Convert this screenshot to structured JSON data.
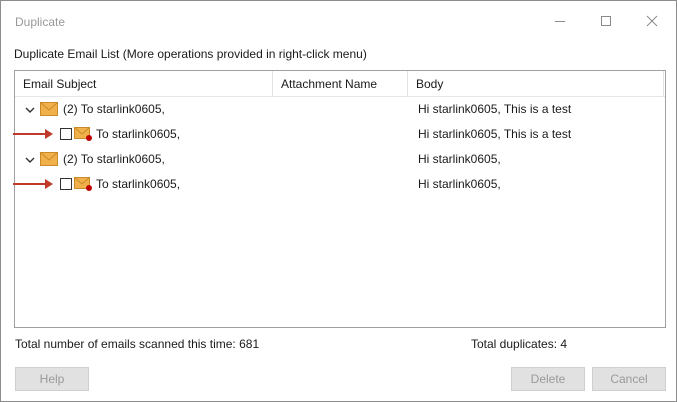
{
  "window": {
    "title": "Duplicate"
  },
  "section_label": "Duplicate Email List (More operations provided in right-click menu)",
  "columns": [
    "Email Subject",
    "Attachment Name",
    "Body"
  ],
  "rows": [
    {
      "kind": "group",
      "subject": "(2) To starlink0605,",
      "attachment": "",
      "body": "Hi starlink0605, This is a test",
      "expanded": true,
      "icon": "envelope-icon"
    },
    {
      "kind": "child",
      "subject": "To starlink0605,",
      "attachment": "",
      "body": "Hi starlink0605, This is a test",
      "checked": false,
      "icon": "envelope-flag-icon",
      "marker": "red-arrow-icon"
    },
    {
      "kind": "group",
      "subject": "(2) To starlink0605,",
      "attachment": "",
      "body": "Hi starlink0605,",
      "expanded": true,
      "icon": "envelope-icon"
    },
    {
      "kind": "child",
      "subject": "To starlink0605,",
      "attachment": "",
      "body": "Hi starlink0605,",
      "checked": false,
      "icon": "envelope-flag-icon",
      "marker": "red-arrow-icon"
    }
  ],
  "status": {
    "scanned": "Total number of emails scanned this time: 681",
    "duplicates": "Total duplicates: 4"
  },
  "buttons": {
    "help": "Help",
    "delete": "Delete",
    "cancel": "Cancel"
  },
  "colors": {
    "arrow": "#c0392b",
    "envelope": "#f0b04a",
    "flag_dot": "#c00000"
  }
}
